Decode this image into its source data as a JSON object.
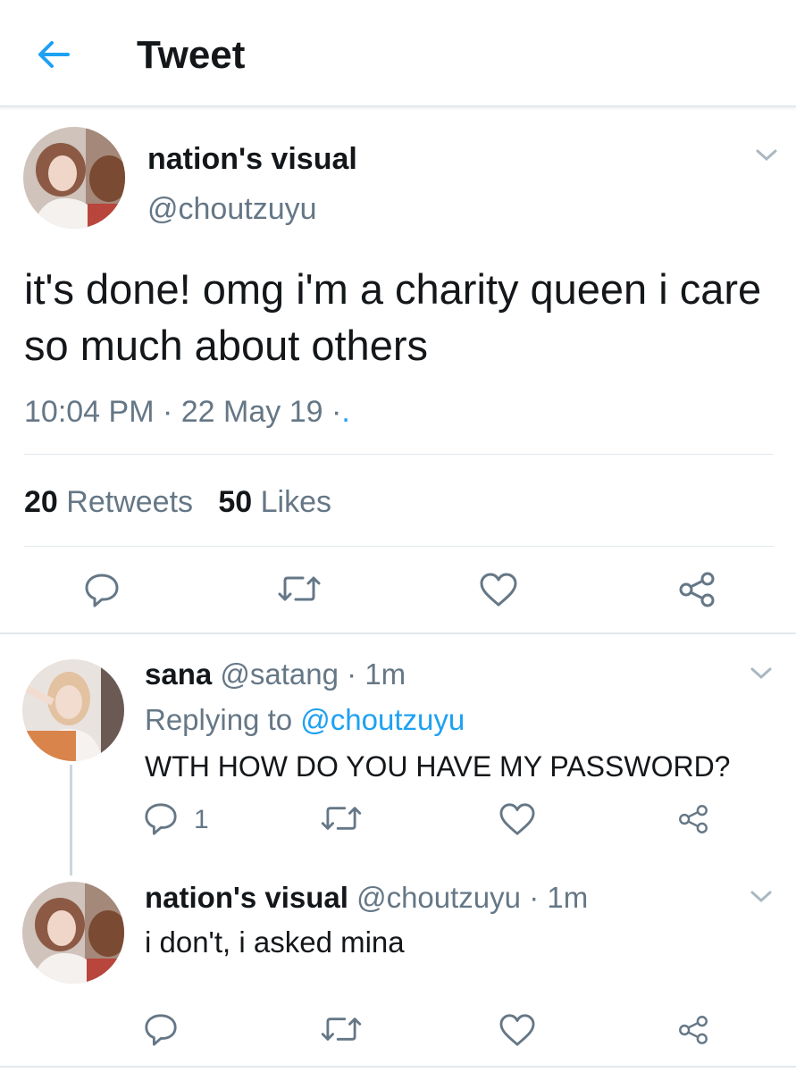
{
  "header": {
    "title": "Tweet"
  },
  "main_tweet": {
    "display_name": "nation's visual",
    "handle": "@choutzuyu",
    "text": "it's done! omg i'm a charity queen i care so much about others",
    "time": "10:04 PM",
    "date": "22 May 19",
    "meta_sep": "·",
    "meta_dot": ".",
    "retweet_count": "20",
    "retweet_label": "Retweets",
    "like_count": "50",
    "like_label": "Likes"
  },
  "replies": [
    {
      "display_name": "sana",
      "handle": "@satang",
      "separator": "·",
      "time": "1m",
      "replying_label": "Replying to",
      "replying_handle": "@choutzuyu",
      "text": "WTH HOW DO YOU HAVE MY PASSWORD?",
      "reply_count": "1"
    },
    {
      "display_name": "nation's visual",
      "handle": "@choutzuyu",
      "separator": "·",
      "time": "1m",
      "text": "i don't, i asked mina"
    }
  ],
  "colors": {
    "accent": "#1da1f2",
    "muted_text": "#657786",
    "primary_text": "#14171a",
    "divider": "#e1e8ed"
  },
  "icons": [
    "back-arrow-icon",
    "chevron-down-icon",
    "reply-icon",
    "retweet-icon",
    "like-icon",
    "share-icon"
  ]
}
